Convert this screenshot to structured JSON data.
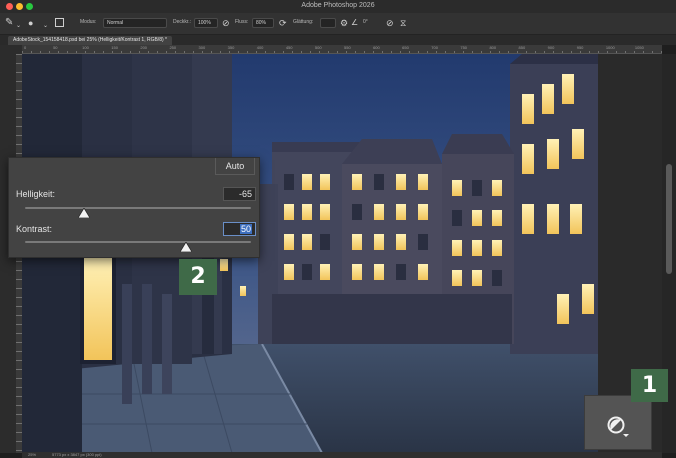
{
  "app": {
    "title": "Adobe Photoshop 2026"
  },
  "options_bar": {
    "mode_label": "Modus:",
    "mode_value": "Normal",
    "opacity_label": "Deckkr.:",
    "opacity_value": "100%",
    "flow_label": "Fluss:",
    "flow_value": "80%",
    "smoothing_label": "Glättung:",
    "angle_value": "0°"
  },
  "document": {
    "tab_title": "AdobeStock_154158418.psd bei 25% (Helligkeit/Kontrast 1, RGB/8) *"
  },
  "ruler": {
    "ticks": [
      "0",
      "50",
      "100",
      "150",
      "200",
      "250",
      "300",
      "350",
      "400",
      "450",
      "500",
      "550",
      "600",
      "650",
      "700",
      "750",
      "800",
      "850",
      "900",
      "950",
      "1000",
      "1050"
    ]
  },
  "status": {
    "zoom": "25%",
    "doc_size": "5773 px x 3847 px (300 ppi)"
  },
  "properties_panel": {
    "auto_label": "Auto",
    "brightness_label": "Helligkeit:",
    "brightness_value": "-65",
    "contrast_label": "Kontrast:",
    "contrast_value": "50"
  },
  "badges": {
    "one": "1",
    "two": "2"
  },
  "icons": {
    "brush": "brush-icon",
    "brush_preset": "brush-preset-icon",
    "panel_toggle": "brush-settings-icon",
    "pressure_opacity": "pressure-opacity-icon",
    "airbrush": "airbrush-icon",
    "settings": "gear-icon",
    "angle": "angle-icon",
    "pressure_size": "pressure-size-icon",
    "symmetry": "symmetry-icon",
    "adjustment": "adjustment-layer-icon"
  },
  "colors": {
    "badge": "#3f6a48",
    "panel": "#434343",
    "selection": "#3d6fbf"
  }
}
